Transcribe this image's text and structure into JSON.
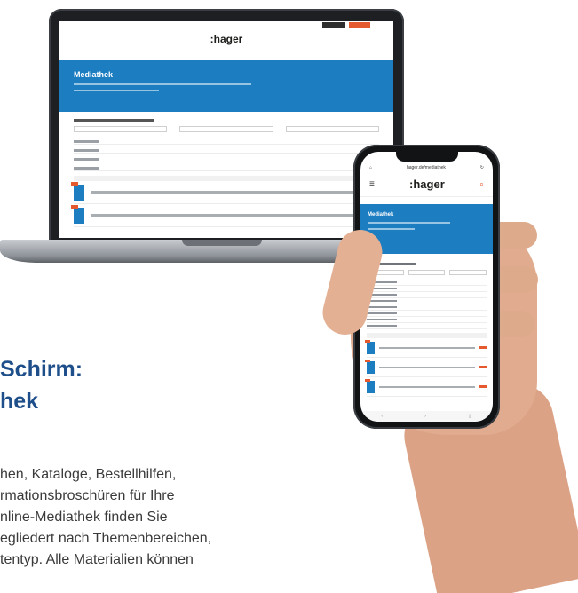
{
  "laptop": {
    "brand": ":hager",
    "hero_title": "Mediathek"
  },
  "phone": {
    "address": "hager.de/mediathek",
    "brand": ":hager",
    "hero_title": "Mediathek",
    "menu_icon": "hamburger-icon",
    "search_icon": "search-icon",
    "tab_icon": "tab-icon",
    "reload_icon": "reload-icon"
  },
  "content": {
    "heading": "  Schirm:\nhek",
    "body": "hen, Kataloge, Bestellhilfen,\nrmationsbroschüren für Ihre\nnline-Mediathek finden Sie\negliedert nach Themenbereichen,\ntentyp. Alle Materialien können"
  },
  "colors": {
    "brand_blue": "#1c7dc1",
    "accent_orange": "#e4592d",
    "heading_blue": "#1f4f8a"
  }
}
